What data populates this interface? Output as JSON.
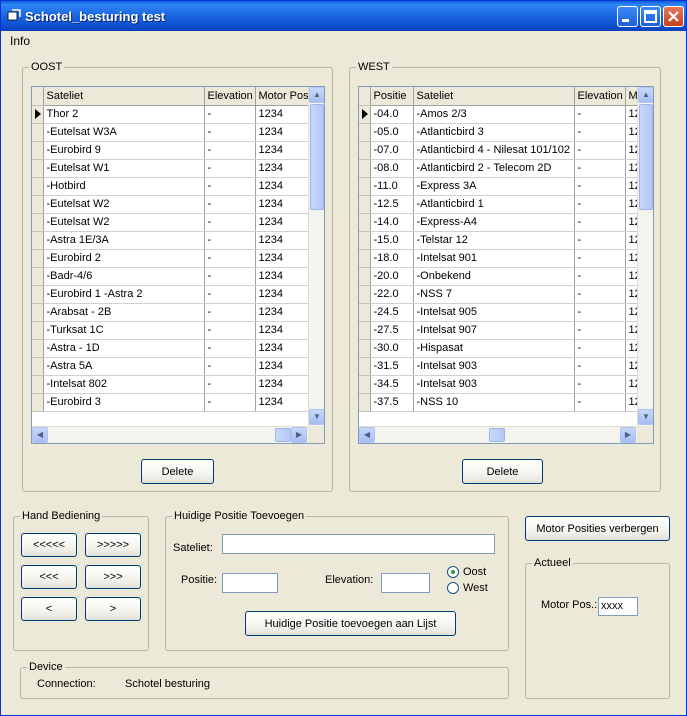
{
  "window": {
    "title": "Schotel_besturing test"
  },
  "menu": {
    "items": [
      "Info"
    ]
  },
  "oost": {
    "label": "OOST",
    "columns": [
      "Sateliet",
      "Elevation",
      "Motor Pos"
    ],
    "rows": [
      [
        "Thor 2",
        "-",
        "1234"
      ],
      [
        "-Eutelsat W3A",
        "-",
        "1234"
      ],
      [
        "-Eurobird 9",
        "-",
        "1234"
      ],
      [
        "-Eutelsat W1",
        "-",
        "1234"
      ],
      [
        "-Hotbird",
        "-",
        "1234"
      ],
      [
        "-Eutelsat W2",
        "-",
        "1234"
      ],
      [
        "-Eutelsat W2",
        "-",
        "1234"
      ],
      [
        "-Astra 1E/3A",
        "-",
        "1234"
      ],
      [
        "-Eurobird 2",
        "-",
        "1234"
      ],
      [
        "-Badr-4/6",
        "-",
        "1234"
      ],
      [
        "-Eurobird 1 -Astra 2",
        "-",
        "1234"
      ],
      [
        "-Arabsat - 2B",
        "-",
        "1234"
      ],
      [
        "-Turksat 1C",
        "-",
        "1234"
      ],
      [
        "-Astra - 1D",
        "-",
        "1234"
      ],
      [
        "-Astra 5A",
        "-",
        "1234"
      ],
      [
        "-Intelsat 802",
        "-",
        "1234"
      ],
      [
        "-Eurobird 3",
        "-",
        "1234"
      ]
    ],
    "delete_label": "Delete"
  },
  "west": {
    "label": "WEST",
    "columns": [
      "Positie",
      "Sateliet",
      "Elevation",
      "M"
    ],
    "rows": [
      [
        "-04.0",
        "-Amos 2/3",
        "-",
        "12"
      ],
      [
        "-05.0",
        "-Atlanticbird 3",
        "-",
        "12"
      ],
      [
        "-07.0",
        "-Atlanticbird 4 - Nilesat 101/102",
        "-",
        "12"
      ],
      [
        "-08.0",
        "-Atlanticbird 2 - Telecom 2D",
        "-",
        "12"
      ],
      [
        "-11.0",
        "-Express 3A",
        "-",
        "12"
      ],
      [
        "-12.5",
        "-Atlanticbird 1",
        "-",
        "12"
      ],
      [
        "-14.0",
        "-Express-A4",
        "-",
        "12"
      ],
      [
        "-15.0",
        "-Telstar 12",
        "-",
        "12"
      ],
      [
        "-18.0",
        "-Intelsat 901",
        "-",
        "12"
      ],
      [
        "-20.0",
        "-Onbekend",
        "-",
        "12"
      ],
      [
        "-22.0",
        "-NSS 7",
        "-",
        "12"
      ],
      [
        "-24.5",
        "-Intelsat 905",
        "-",
        "12"
      ],
      [
        "-27.5",
        "-Intelsat 907",
        "-",
        "12"
      ],
      [
        "-30.0",
        "-Hispasat",
        "-",
        "12"
      ],
      [
        "-31.5",
        "-Intelsat 903",
        "-",
        "12"
      ],
      [
        "-34.5",
        "-Intelsat 903",
        "-",
        "12"
      ],
      [
        "-37.5",
        "-NSS 10",
        "-",
        "12"
      ]
    ],
    "delete_label": "Delete"
  },
  "hand": {
    "label": "Hand Bediening",
    "buttons": [
      "<<<<<",
      ">>>>>",
      "<<<",
      ">>>",
      "<",
      ">"
    ]
  },
  "add": {
    "label": "Huidige Positie Toevoegen",
    "sateliet_label": "Sateliet:",
    "sateliet_value": "",
    "positie_label": "Positie:",
    "positie_value": "",
    "elevation_label": "Elevation:",
    "elevation_value": "",
    "radio_oost": "Oost",
    "radio_west": "West",
    "selected": "Oost",
    "add_button": "Huidige Positie toevoegen aan Lijst"
  },
  "motor_toggle": "Motor Posities verbergen",
  "actueel": {
    "label": "Actueel",
    "motor_label": "Motor Pos.:",
    "motor_value": "xxxx"
  },
  "device": {
    "label": "Device",
    "connection_label": "Connection:",
    "connection_value": "Schotel besturing"
  }
}
